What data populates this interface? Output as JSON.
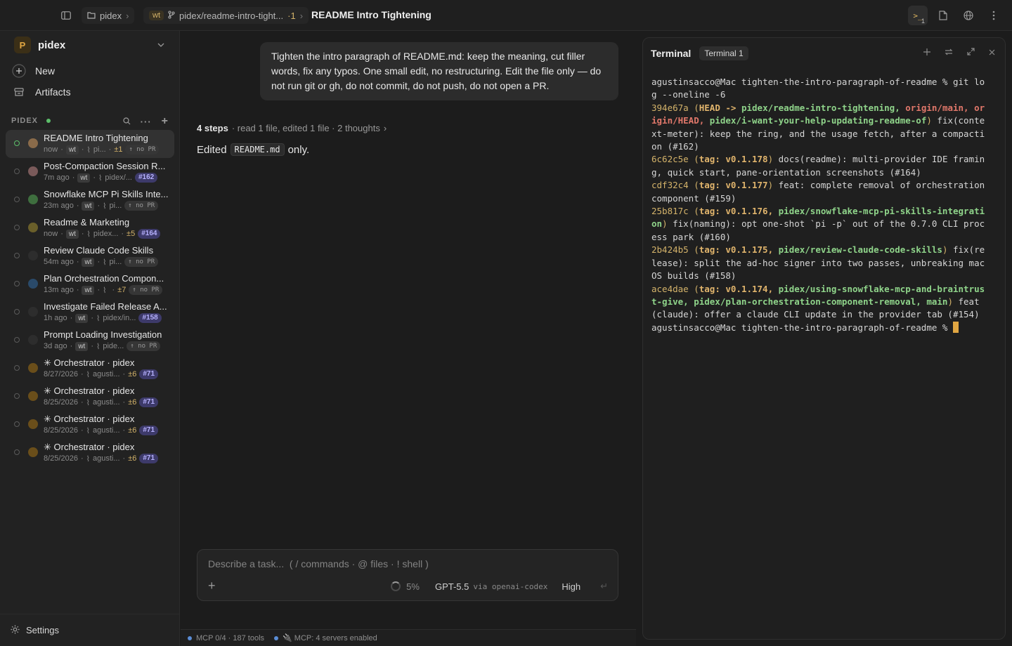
{
  "topbar": {
    "project_crumb": "pidex",
    "branch_badge": "wt",
    "branch": "pidex/readme-intro-tight...",
    "branch_count": "·1",
    "title": "README Intro Tightening",
    "terminal_count": "1"
  },
  "sidebar": {
    "project_initial": "P",
    "project_name": "pidex",
    "new_label": "New",
    "artifacts_label": "Artifacts",
    "section_label": "PIDEX",
    "settings_label": "Settings",
    "sessions": [
      {
        "title": "README Intro Tightening",
        "time": "now",
        "wt": "wt",
        "branch": "pi...",
        "changes": "±1",
        "pr": "↑ no PR",
        "active": true
      },
      {
        "title": "Post-Compaction Session R...",
        "time": "7m ago",
        "wt": "wt",
        "branch": "pidex/...",
        "changes": "",
        "pr": "#162"
      },
      {
        "title": "Snowflake MCP Pi Skills Inte...",
        "time": "23m ago",
        "wt": "wt",
        "branch": "pi...",
        "changes": "",
        "pr": "↑ no PR"
      },
      {
        "title": "Readme & Marketing",
        "time": "now",
        "wt": "wt",
        "branch": "pidex...",
        "changes": "±5",
        "pr": "#164"
      },
      {
        "title": "Review Claude Code Skills",
        "time": "54m ago",
        "wt": "wt",
        "branch": "pi...",
        "changes": "",
        "pr": "↑ no PR"
      },
      {
        "title": "Plan Orchestration Compon...",
        "time": "13m ago",
        "wt": "wt",
        "branch": "",
        "changes": "±7",
        "pr": "↑ no PR"
      },
      {
        "title": "Investigate Failed Release A...",
        "time": "1h ago",
        "wt": "wt",
        "branch": "pidex/in...",
        "changes": "",
        "pr": "#158"
      },
      {
        "title": "Prompt Loading Investigation",
        "time": "3d ago",
        "wt": "wt",
        "branch": "pide...",
        "changes": "",
        "pr": "↑ no PR"
      },
      {
        "title": "✳ Orchestrator · pidex",
        "time": "8/27/2026",
        "wt": "",
        "branch": "agusti...",
        "changes": "±6",
        "pr": "#71"
      },
      {
        "title": "✳ Orchestrator · pidex",
        "time": "8/25/2026",
        "wt": "",
        "branch": "agusti...",
        "changes": "±6",
        "pr": "#71"
      },
      {
        "title": "✳ Orchestrator · pidex",
        "time": "8/25/2026",
        "wt": "",
        "branch": "agusti...",
        "changes": "±6",
        "pr": "#71"
      },
      {
        "title": "✳ Orchestrator · pidex",
        "time": "8/25/2026",
        "wt": "",
        "branch": "agusti...",
        "changes": "±6",
        "pr": "#71"
      }
    ]
  },
  "chat": {
    "user_message": "Tighten the intro paragraph of README.md: keep the meaning, cut filler words, fix any typos. One small edit, no restructuring. Edit the file only — do not run git or gh, do not commit, do not push, do not open a PR.",
    "steps_count": "4 steps",
    "steps_detail": "· read 1 file, edited 1 file · 2 thoughts",
    "edited_prefix": "Edited",
    "edited_file": "README.md",
    "edited_suffix": "only."
  },
  "composer": {
    "placeholder": "Describe a task...  ( / commands · @ files · ! shell )",
    "context_pct": "5%",
    "model": "GPT-5.5",
    "provider": "via openai-codex",
    "effort": "High"
  },
  "statusbar": {
    "mcp_tools": "MCP 0/4 · 187 tools",
    "mcp_servers": "MCP: 4 servers enabled"
  },
  "terminal": {
    "title": "Terminal",
    "tab": "Terminal 1",
    "prompt": "agustinsacco@Mac tighten-the-intro-paragraph-of-readme %",
    "command": "git log --oneline -6",
    "commits": [
      {
        "hash": "394e67a",
        "refs_head": "HEAD -> ",
        "refs_a": "pidex/readme-intro-tightening, ",
        "refs_b": "origin/main, origin/HEAD, ",
        "refs_c": "pidex/i-want-your-help-updating-readme-of",
        "msg": " fix(context-meter): keep the ring, and the usage fetch, after a compaction (#162)"
      },
      {
        "hash": "6c62c5e",
        "refs_tag": "tag: v0.1.178",
        "msg": " docs(readme): multi-provider IDE framing, quick start, pane-orientation screenshots (#164)"
      },
      {
        "hash": "cdf32c4",
        "refs_tag": "tag: v0.1.177",
        "msg": " feat: complete removal of orchestration component (#159)"
      },
      {
        "hash": "25b817c",
        "refs_tag": "tag: v0.1.176, ",
        "refs_branch": "pidex/snowflake-mcp-pi-skills-integration",
        "msg": " fix(naming): opt one-shot `pi -p` out of the 0.7.0 CLI process park (#160)"
      },
      {
        "hash": "2b424b5",
        "refs_tag": "tag: v0.1.175, ",
        "refs_branch": "pidex/review-claude-code-skills",
        "msg": " fix(release): split the ad-hoc signer into two passes, unbreaking macOS builds (#158)"
      },
      {
        "hash": "ace4dae",
        "refs_tag": "tag: v0.1.174, ",
        "refs_branch": "pidex/using-snowflake-mcp-and-braintrust-give, pidex/plan-orchestration-component-removal, main",
        "msg": " feat(claude): offer a claude CLI update in the provider tab (#154)"
      }
    ]
  },
  "colors": {
    "accent": "#e0a642",
    "pr_badge": "#3d3a6a",
    "terminal_branch": "#8fd48a",
    "terminal_origin": "#e0776a"
  }
}
